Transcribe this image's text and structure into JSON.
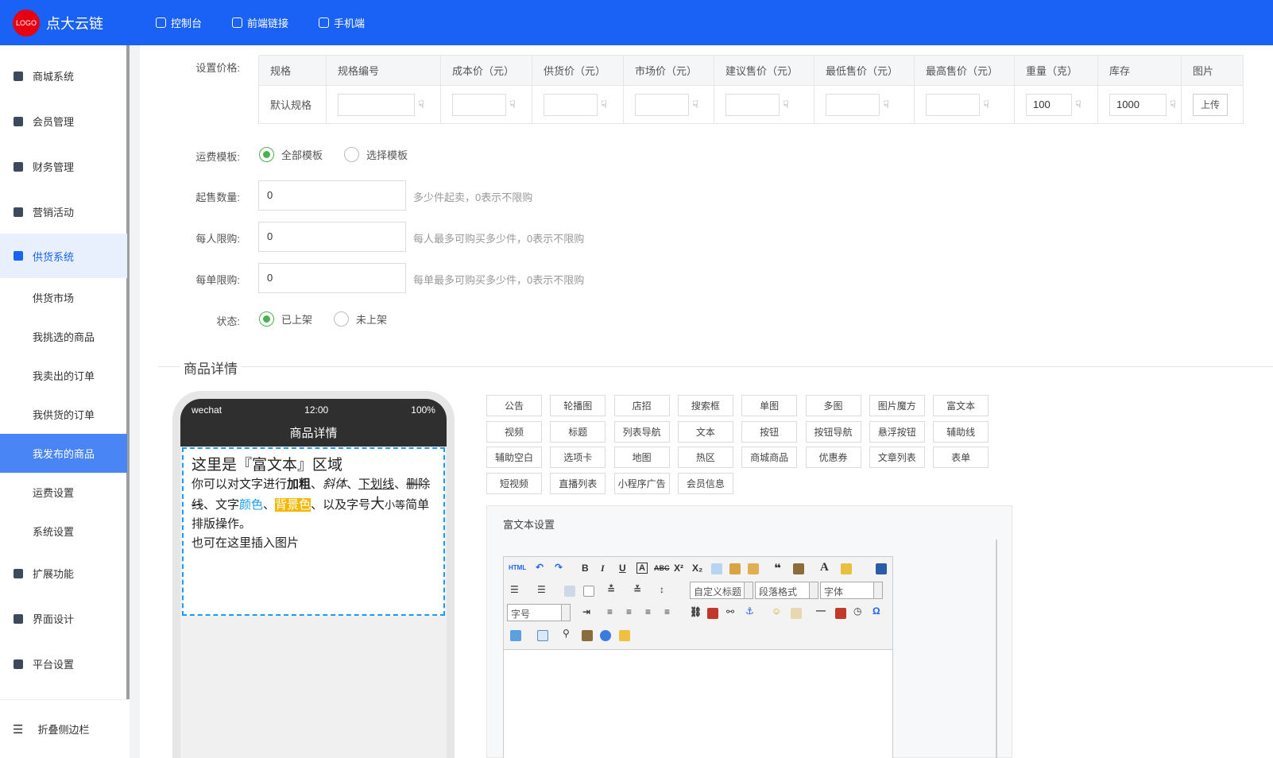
{
  "header": {
    "logo_text": "LOGO",
    "brand": "点大云链",
    "nav": [
      {
        "label": "控制台",
        "icon": "dashboard-icon"
      },
      {
        "label": "前端链接",
        "icon": "link-icon"
      },
      {
        "label": "手机端",
        "icon": "phone-icon"
      }
    ]
  },
  "sidebar": {
    "items": [
      {
        "label": "商城系统",
        "icon": "bag-icon"
      },
      {
        "label": "会员管理",
        "icon": "diamond-icon"
      },
      {
        "label": "财务管理",
        "icon": "wallet-icon"
      },
      {
        "label": "营销活动",
        "icon": "gift-icon"
      },
      {
        "label": "供货系统",
        "icon": "truck-icon"
      }
    ],
    "sub": [
      "供货市场",
      "我挑选的商品",
      "我卖出的订单",
      "我供货的订单",
      "我发布的商品",
      "运费设置",
      "系统设置"
    ],
    "bottom": [
      {
        "label": "扩展功能",
        "icon": "puzzle-icon"
      },
      {
        "label": "界面设计",
        "icon": "layout-icon"
      },
      {
        "label": "平台设置",
        "icon": "monitor-icon"
      }
    ],
    "collapse": "折叠侧边栏"
  },
  "price": {
    "label": "设置价格:",
    "headers": [
      "规格",
      "规格编号",
      "成本价（元）",
      "供货价（元）",
      "市场价（元）",
      "建议售价（元）",
      "最低售价（元）",
      "最高售价（元）",
      "重量（克）",
      "库存",
      "图片"
    ],
    "row": {
      "spec": "默认规格",
      "weight": "100",
      "stock": "1000",
      "upload": "上传"
    }
  },
  "form": {
    "shipping_label": "运费模板:",
    "shipping_opts": [
      "全部模板",
      "选择模板"
    ],
    "min_label": "起售数量:",
    "min_value": "0",
    "min_hint": "多少件起卖，0表示不限购",
    "per_person_label": "每人限购:",
    "per_person_value": "0",
    "per_person_hint": "每人最多可购买多少件，0表示不限购",
    "per_order_label": "每单限购:",
    "per_order_value": "0",
    "per_order_hint": "每单最多可购买多少件，0表示不限购",
    "status_label": "状态:",
    "status_opts": [
      "已上架",
      "未上架"
    ]
  },
  "detail": {
    "title": "商品详情",
    "phone": {
      "signal": "wechat",
      "time": "12:00",
      "battery": "100%",
      "title": "商品详情",
      "rt_title": "这里是『富文本』区域",
      "rt": {
        "a": "你可以对文字进行",
        "bold": "加粗",
        "sep1": "、",
        "italic": "斜体",
        "sep2": "、",
        "under": "下划线",
        "sep3": "、",
        "strike": "删除线",
        "b": "、文字",
        "color": "颜色",
        "sep4": "、",
        "bg": "背景色",
        "c": "、以及字号",
        "big": "大",
        "small": "小等",
        "d": "简单排版操作。",
        "line2": "也可在这里插入图片"
      }
    },
    "widgets": [
      "公告",
      "轮播图",
      "店招",
      "搜索框",
      "单图",
      "多图",
      "图片魔方",
      "富文本",
      "视频",
      "标题",
      "列表导航",
      "文本",
      "按钮",
      "按钮导航",
      "悬浮按钮",
      "辅助线",
      "辅助空白",
      "选项卡",
      "地图",
      "热区",
      "商城商品",
      "优惠券",
      "文章列表",
      "表单",
      "短视频",
      "直播列表",
      "小程序广告",
      "会员信息"
    ],
    "rt_settings": "富文本设置",
    "toolbar": {
      "html": "HTML",
      "custom_title": "自定义标题",
      "paragraph": "段落格式",
      "font": "字体",
      "size": "字号"
    }
  }
}
